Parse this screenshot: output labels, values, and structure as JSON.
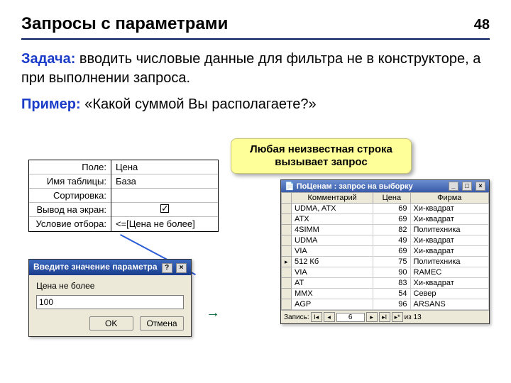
{
  "page_number": "48",
  "title": "Запросы с параметрами",
  "task_label": "Задача:",
  "task_text": " вводить числовые данные для фильтра не в конструкторе, а при выполнении запроса.",
  "example_label": "Пример:",
  "example_text": " «Какой суммой Вы располагаете?»",
  "designer": {
    "labels": {
      "field": "Поле:",
      "table": "Имя таблицы:",
      "sort": "Сортировка:",
      "show": "Вывод на экран:",
      "criteria": "Условие отбора:"
    },
    "values": {
      "field": "Цена",
      "table": "База",
      "sort": "",
      "criteria": "<=[Цена не более]"
    }
  },
  "callout_text": "Любая неизвестная строка вызывает запрос",
  "param_dialog": {
    "title": "Введите значение параметра",
    "prompt": "Цена не более",
    "value": "100",
    "ok": "OK",
    "cancel": "Отмена"
  },
  "results": {
    "title": "ПоЦенам : запрос на выборку",
    "columns": [
      "Комментарий",
      "Цена",
      "Фирма"
    ],
    "rows": [
      [
        "UDMA, ATX",
        "69",
        "Хи-квадрат"
      ],
      [
        "ATX",
        "69",
        "Хи-квадрат"
      ],
      [
        "4SIMM",
        "82",
        "Политехника"
      ],
      [
        "UDMA",
        "49",
        "Хи-квадрат"
      ],
      [
        "VIA",
        "69",
        "Хи-квадрат"
      ],
      [
        "512 Кб",
        "75",
        "Политехника"
      ],
      [
        "VIA",
        "90",
        "RAMEC"
      ],
      [
        "AT",
        "83",
        "Хи-квадрат"
      ],
      [
        "MMX",
        "54",
        "Север"
      ],
      [
        "AGP",
        "96",
        "ARSANS"
      ]
    ],
    "nav_label": "Запись:",
    "nav_pos": "6",
    "nav_total": "из  13"
  }
}
